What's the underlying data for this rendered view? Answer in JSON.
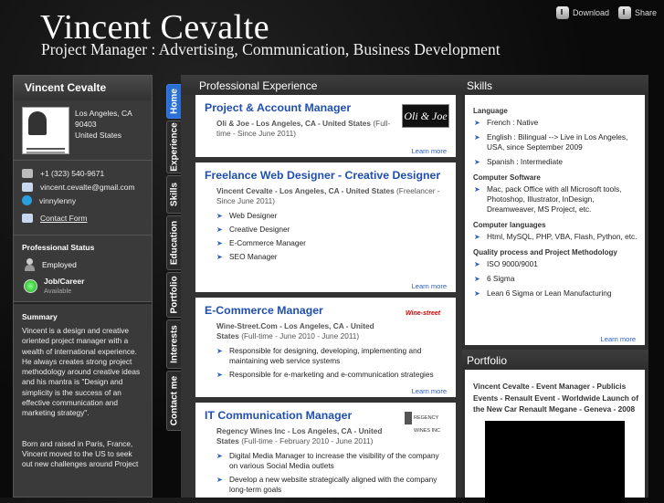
{
  "header": {
    "name": "Vincent Cevalte",
    "subtitle": "Project Manager : Advertising, Communication, Business Development",
    "download_label": "Download",
    "share_label": "Share"
  },
  "sidebar": {
    "title": "Vincent Cevalte",
    "location": [
      "Los Angeles, CA",
      "90403",
      "United States"
    ],
    "phone": "+1 (323) 540-9671",
    "email": "vincent.cevalte@gmail.com",
    "skype": "vinnylenny",
    "contact_form": "Contact Form",
    "status_heading": "Professional Status",
    "employed": "Employed",
    "job_label": "Job/Career",
    "available": "Available",
    "summary_heading": "Summary",
    "summary_p1": "Vincent is a design and creative oriented project manager with a wealth of international experience. He always creates strong project methodology around creative ideas and his mantra is \"Design and simplicity is the success of an effective communication and marketing strategy\".",
    "summary_p2": "Born and raised in Paris, France, Vincent moved to the US to seek out new challenges around Project"
  },
  "tabs": [
    "Home",
    "Experience",
    "Skills",
    "Education",
    "Portfolio",
    "Interests",
    "Contact me"
  ],
  "experience": {
    "heading": "Professional Experience",
    "more_label": "Learn more",
    "jobs": [
      {
        "title": "Project & Account Manager",
        "org": "Oli & Joe - Los Angeles, CA - United States",
        "period": "(Full-time - Since June 2011)",
        "logo": "Oli & Joe",
        "bullets": []
      },
      {
        "title": "Freelance Web Designer - Creative Designer",
        "org": "Vincent Cevalte - Los Angeles, CA - United States",
        "period": "(Freelancer - Since June 2011)",
        "bullets": [
          "Web Designer",
          "Creative Designer",
          "E-Commerce Manager",
          "SEO Manager"
        ]
      },
      {
        "title": "E-Commerce Manager",
        "org": "Wine-Street.Com - Los Angeles, CA - United States",
        "period": "(Full-time - June 2010 - June 2011)",
        "logo": "Wine-street",
        "bullets": [
          "Responsible for designing, developing, implementing and maintaining web service systems",
          "Responsible for e-marketing and e-communication strategies"
        ]
      },
      {
        "title": "IT Communication Manager",
        "org": "Regency Wines Inc - Los Angeles, CA - United States",
        "period": "(Full-time - February 2010 - June 2011)",
        "logo": "REGENCY WINES INC",
        "bullets": [
          "Digital Media Manager to increase the visibility of the company on various Social Media outlets",
          "Develop a new website strategically aligned with the company long-term goals"
        ]
      }
    ]
  },
  "skills": {
    "heading": "Skills",
    "more_label": "Learn more",
    "groups": [
      {
        "name": "Language",
        "items": [
          "French : Native",
          "English : Bilingual --> Live in Los Angeles, USA, since September 2009",
          "Spanish : Intermediate"
        ]
      },
      {
        "name": "Computer Software",
        "items": [
          "Mac, pack Office with all Microsoft tools, Photoshop, Illustrator, InDesign, Dreamweaver, MS Project, etc."
        ]
      },
      {
        "name": "Computer languages",
        "items": [
          "Html, MySQL, PHP, VBA, Flash, Python, etc."
        ]
      },
      {
        "name": "Quality process and Project Methodology",
        "items": [
          "ISO 9000/9001",
          "6 Sigma",
          "Lean 6 Sigma or Lean Manufacturing"
        ]
      }
    ]
  },
  "portfolio": {
    "heading": "Portfolio",
    "caption": "Vincent Cevalte - Event Manager - Publicis Events - Renault Event - Worldwide Launch of the New Car Renault Megane - Geneva - 2008"
  }
}
